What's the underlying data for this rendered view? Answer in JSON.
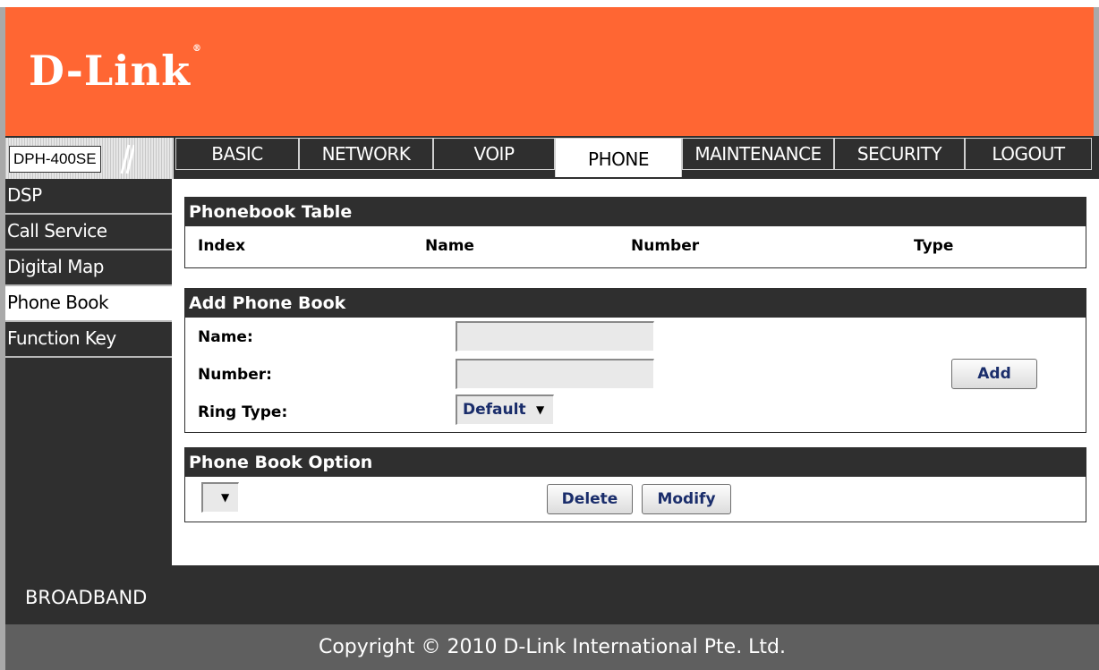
{
  "brand": {
    "logo_text": "D-Link",
    "registered": "®"
  },
  "model": "DPH-400SE",
  "nav_tabs": [
    {
      "label": "BASIC"
    },
    {
      "label": "NETWORK"
    },
    {
      "label": "VOIP"
    },
    {
      "label": "PHONE"
    },
    {
      "label": "MAINTENANCE"
    },
    {
      "label": "SECURITY"
    },
    {
      "label": "LOGOUT"
    }
  ],
  "active_tab": "PHONE",
  "sidebar": {
    "items": [
      {
        "label": "DSP"
      },
      {
        "label": "Call Service"
      },
      {
        "label": "Digital Map"
      },
      {
        "label": "Phone Book"
      },
      {
        "label": "Function Key"
      }
    ],
    "active": "Phone Book"
  },
  "phonebook_table": {
    "title": "Phonebook Table",
    "columns": [
      "Index",
      "Name",
      "Number",
      "Type"
    ]
  },
  "add_phone_book": {
    "title": "Add Phone Book",
    "name_label": "Name:",
    "name_value": "",
    "number_label": "Number:",
    "number_value": "",
    "ring_type_label": "Ring Type:",
    "ring_type_value": "Default",
    "add_button": "Add"
  },
  "phone_book_option": {
    "title": "Phone Book Option",
    "select_value": "",
    "delete_button": "Delete",
    "modify_button": "Modify"
  },
  "footer": {
    "broadband": "BROADBAND",
    "copyright": "Copyright © 2010 D-Link International Pte. Ltd."
  },
  "colors": {
    "header_orange": "#ff6633",
    "dark_panel": "#2f2f2f",
    "button_text": "#1a2d6b",
    "footer_gray": "#5f5f5f"
  }
}
